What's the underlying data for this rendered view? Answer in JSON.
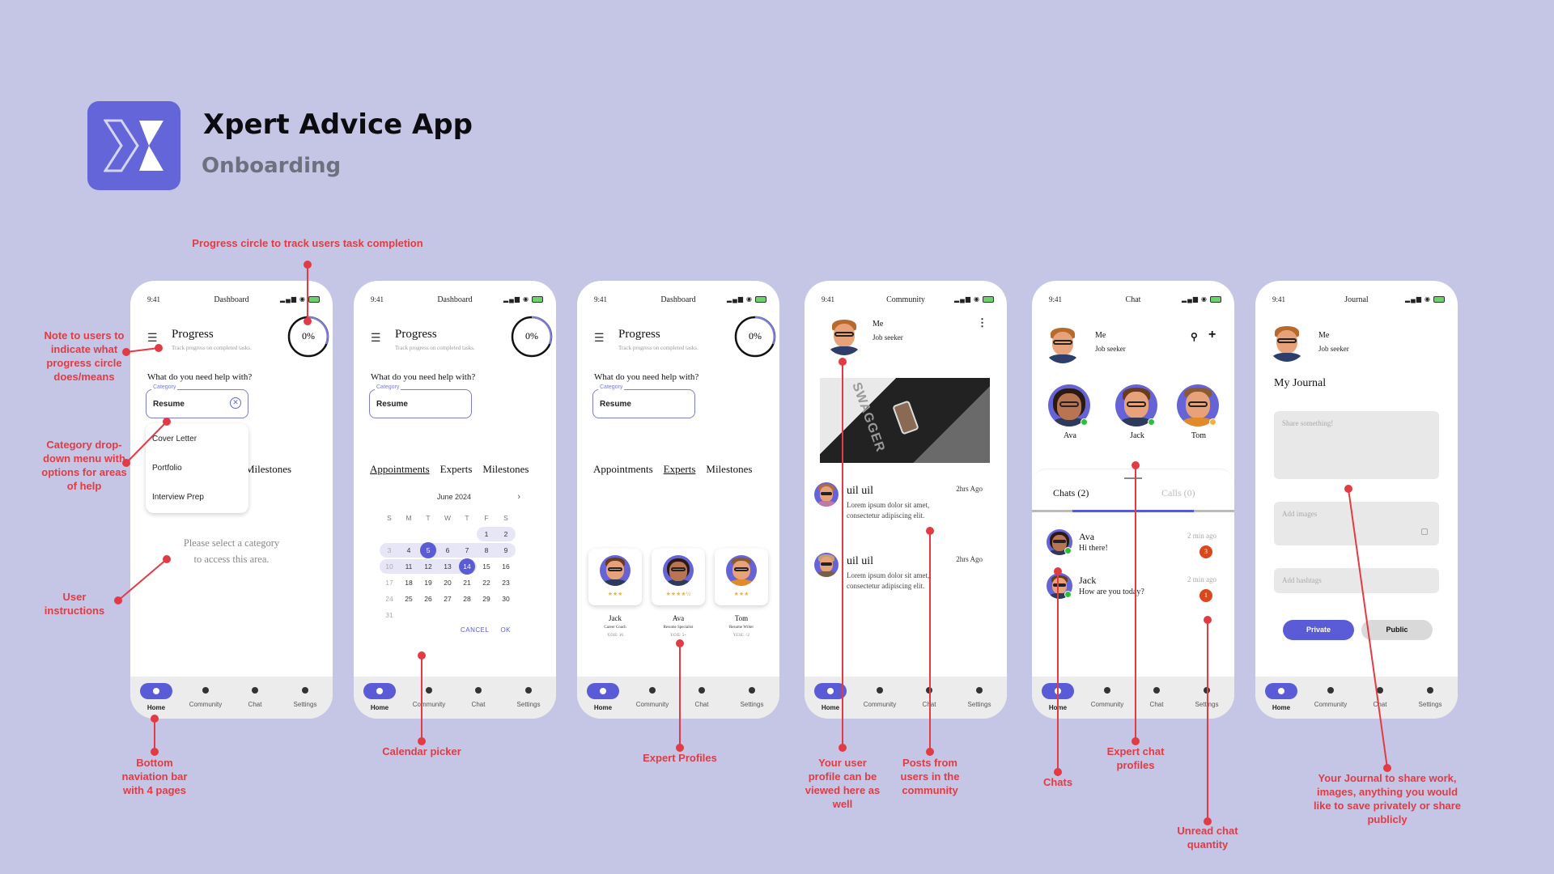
{
  "header": {
    "title": "Xpert Advice App",
    "subtitle": "Onboarding",
    "logo_icon": "x-logo-icon"
  },
  "colors": {
    "background": "#c5c6e5",
    "accent": "#5a5bd6",
    "annotation": "#e23b44",
    "unread": "#d9471c",
    "online": "#2bbf3a",
    "away": "#f2b33a"
  },
  "status_bar": {
    "time": "9:41",
    "icons": [
      "signal-icon",
      "wifi-icon",
      "battery-charging-icon"
    ]
  },
  "nav": {
    "items": [
      "Home",
      "Community",
      "Chat",
      "Settings"
    ],
    "active": "Home"
  },
  "dashboard": {
    "header": "Dashboard",
    "progress_title": "Progress",
    "progress_subtitle": "Track progress on completed tasks.",
    "progress_value": "0%",
    "progress_fraction": 0,
    "question": "What do you need help with?",
    "category_label": "Category",
    "category_value": "Resume",
    "dropdown_options": [
      "Cover Letter",
      "Portfolio",
      "Interview Prep"
    ],
    "tabs": [
      "Appointments",
      "Experts",
      "Milestones"
    ],
    "tab_partial": "rts",
    "instructions": "Please select a category to access this area.",
    "instructions_line1": "Please select a category",
    "instructions_line2": "to access this area."
  },
  "calendar": {
    "month": "June 2024",
    "weekdays": [
      "S",
      "M",
      "T",
      "W",
      "T",
      "F",
      "S"
    ],
    "weeks": [
      [
        "",
        "",
        "",
        "",
        "",
        "1",
        "2"
      ],
      [
        "3",
        "4",
        "5",
        "6",
        "7",
        "8",
        "9"
      ],
      [
        "10",
        "11",
        "12",
        "13",
        "14",
        "15",
        "16"
      ],
      [
        "17",
        "18",
        "19",
        "20",
        "21",
        "22",
        "23"
      ],
      [
        "24",
        "25",
        "26",
        "27",
        "28",
        "29",
        "30"
      ],
      [
        "31",
        "",
        "",
        "",
        "",
        "",
        ""
      ]
    ],
    "selected": [
      "5",
      "14"
    ],
    "cancel": "CANCEL",
    "ok": "OK",
    "next_icon": "chevron-right-icon"
  },
  "experts": [
    {
      "name": "Jack",
      "role": "Career Coach",
      "yoe": "Y.O.E: 10",
      "stars": "★★★",
      "rating": 3
    },
    {
      "name": "Ava",
      "role": "Resume Specialist",
      "yoe": "Y.O.E: 5+",
      "stars": "★★★★½",
      "rating": 4.5
    },
    {
      "name": "Tom",
      "role": "Resume Writer",
      "yoe": "Y.O.E: <2",
      "stars": "★★★",
      "rating": 3
    }
  ],
  "community": {
    "header": "Community",
    "me_name": "Me",
    "me_role": "Job seeker",
    "more_icon": "more-vertical-icon",
    "image_alt": "SWAGGER magazine flat lay",
    "image_text": "SWAGGER",
    "posts": [
      {
        "name": "uil uil",
        "time": "2hrs Ago",
        "body": "Lorem ipsum dolor sit amet, consectetur adipiscing elit."
      },
      {
        "name": "uil uil",
        "time": "2hrs Ago",
        "body": "Lorem ipsum dolor sit amet, consectetur adipiscing elit."
      }
    ]
  },
  "chat": {
    "header": "Chat",
    "me_name": "Me",
    "me_role": "Job seeker",
    "search_icon": "search-icon",
    "add_icon": "plus-icon",
    "contacts": [
      {
        "name": "Ava",
        "status": "online"
      },
      {
        "name": "Jack",
        "status": "online"
      },
      {
        "name": "Tom",
        "status": "away"
      }
    ],
    "tabs": [
      "Chats (2)",
      "Calls (0)"
    ],
    "threads": [
      {
        "name": "Ava",
        "message": "Hi there!",
        "time": "2 min ago",
        "unread": "3"
      },
      {
        "name": "Jack",
        "message": "How are you today?",
        "time": "2 min ago",
        "unread": "1"
      }
    ]
  },
  "journal": {
    "header": "Journal",
    "me_name": "Me",
    "me_role": "Job seeker",
    "title": "My Journal",
    "share_placeholder": "Share something!",
    "images_placeholder": "Add images",
    "hashtags_placeholder": "Add hashtags",
    "private_label": "Private",
    "public_label": "Public"
  },
  "annotations": {
    "progress_circle": "Progress circle to track users task completion",
    "note": "Note to users to indicate what progress circle does/means",
    "dropdown": "Category drop-down menu with options for areas of help",
    "instructions": "User instructions",
    "navbar": "Bottom naviation bar with 4 pages",
    "calendar": "Calendar picker",
    "experts": "Expert Profiles",
    "profile": "Your user profile can be viewed here as well",
    "posts": "Posts from users in the community",
    "chats": "Chats",
    "expert_chat": "Expert chat profiles",
    "unread": "Unread chat quantity",
    "journal": "Your Journal to share work, images, anything you would like to save privately or share publicly"
  }
}
